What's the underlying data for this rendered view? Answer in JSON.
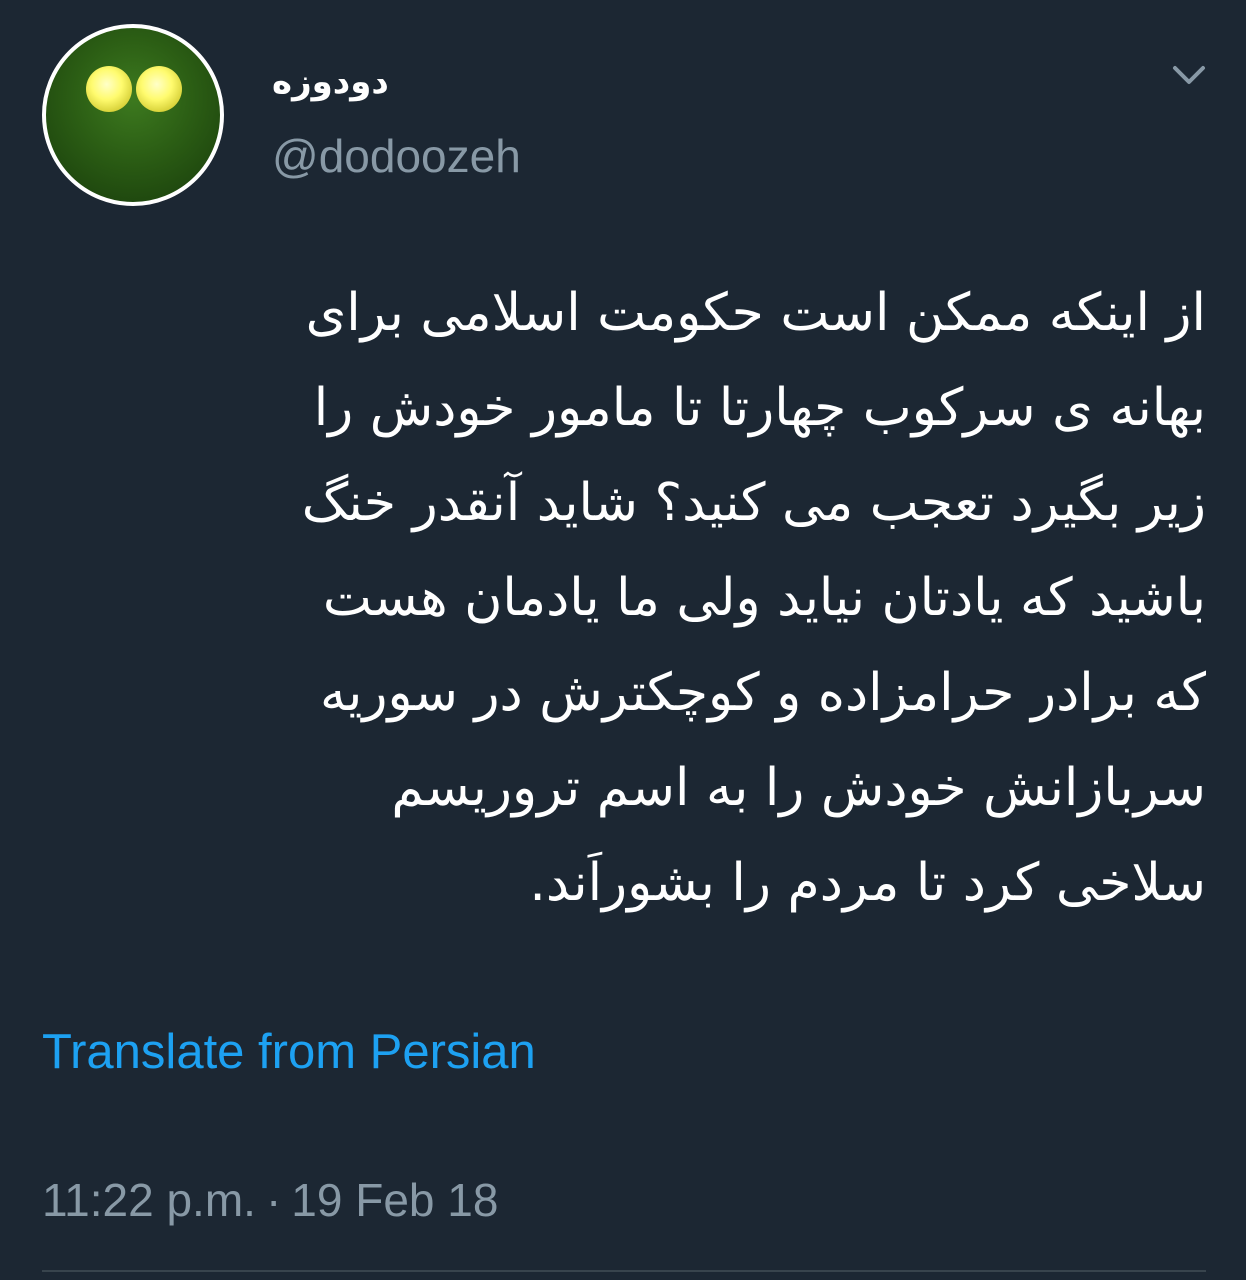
{
  "user": {
    "display_name": "دودوزه",
    "handle": "@dodoozeh",
    "avatar_icon": "green-face-icon"
  },
  "tweet": {
    "text": "از اینکه ممکن است حکومت اسلامی برای\nبهانه ی سرکوب چهارتا تا مامور خودش را\nزیر بگیرد تعجب می کنید؟ شاید آنقدر خنگ\nباشید که یادتان نیاید ولی ما یادمان هست\nکه برادر حرامزاده و کوچکترش در سوریه\nسربازانش خودش را به اسم تروریسم\nسلاخی کرد تا مردم را بشوراَند.",
    "translate_label": "Translate from Persian",
    "time": "11:22 p.m.",
    "separator": "·",
    "date": "19 Feb 18"
  },
  "icons": {
    "more": "chevron-down-icon"
  },
  "colors": {
    "background": "#1c2733",
    "text": "#ffffff",
    "secondary": "#8899a6",
    "link": "#1da1f2",
    "divider": "#38444d"
  }
}
